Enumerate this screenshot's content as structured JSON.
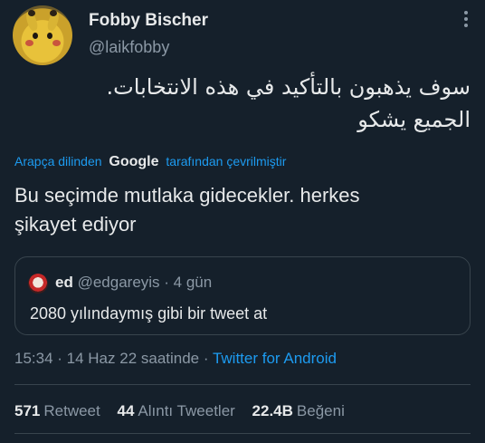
{
  "tweet": {
    "display_name": "Fobby Bischer",
    "handle": "@laikfobby",
    "text_lines": [
      "سوف يذهبون بالتأكيد في هذه الانتخابات.",
      "الجميع يشكو"
    ],
    "translated_prefix": "Arapça dilinden",
    "translated_brand": "Google",
    "translated_suffix": "tarafından çevrilmiştir",
    "translation_lines": [
      "Bu seçimde mutlaka gidecekler. herkes",
      "şikayet ediyor"
    ],
    "timestamp": "15:34 · 14 Haz 22 saatinde · ",
    "via": "Twitter for Android"
  },
  "quote": {
    "name": "ed",
    "handle_time": "@edgareyis · 4 gün",
    "text": "2080 yılındaymış gibi bir tweet at"
  },
  "stats": {
    "retweet_count": "571",
    "retweet_label": "Retweet",
    "quote_count": "44",
    "quote_label": "Alıntı Tweetler",
    "like_count": "22.4B",
    "like_label": "Beğeni"
  },
  "colors": {
    "background": "#15202b",
    "accent": "#1d9bf0",
    "muted": "#8b98a5",
    "text": "#e7e9ea"
  },
  "icons": {
    "more": "more-icon"
  }
}
